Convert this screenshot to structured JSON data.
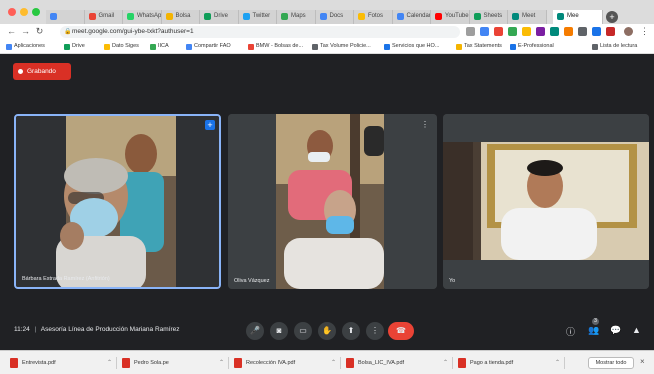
{
  "browser": {
    "tabs": [
      {
        "label": "",
        "color": "#4285f4"
      },
      {
        "label": "Gmail",
        "color": "#ea4335"
      },
      {
        "label": "WhatsApp",
        "color": "#25d366"
      },
      {
        "label": "Bolsa",
        "color": "#f4b400"
      },
      {
        "label": "Drive",
        "color": "#0f9d58"
      },
      {
        "label": "Twitter",
        "color": "#1da1f2"
      },
      {
        "label": "Maps",
        "color": "#34a853"
      },
      {
        "label": "Docs",
        "color": "#4285f4"
      },
      {
        "label": "Fotos",
        "color": "#fbbc04"
      },
      {
        "label": "Calendar",
        "color": "#4285f4"
      },
      {
        "label": "YouTube",
        "color": "#ff0000"
      },
      {
        "label": "Sheets",
        "color": "#0f9d58"
      },
      {
        "label": "Meet",
        "color": "#00897b"
      }
    ],
    "active_tab_label": "Mee",
    "url": "meet.google.com/gui-ybe-txkt?authuser=1",
    "bookmarks": [
      {
        "label": "Aplicaciones",
        "color": "#4285f4"
      },
      {
        "label": "Drive",
        "color": "#0f9d58"
      },
      {
        "label": "Dato Siges",
        "color": "#fbbc04"
      },
      {
        "label": "IICA",
        "color": "#34a853"
      },
      {
        "label": "Compartir FAO",
        "color": "#4285f4"
      },
      {
        "label": "BMW - Bolsas de...",
        "color": "#ea4335"
      },
      {
        "label": "Tax Volume Policie...",
        "color": "#5f6368"
      },
      {
        "label": "Servicios que HO...",
        "color": "#1a73e8"
      },
      {
        "label": "Tax Statements",
        "color": "#f4b400"
      },
      {
        "label": "E-Professional",
        "color": "#1a73e8"
      },
      {
        "label": "Lista de lectura",
        "color": "#5f6368"
      }
    ]
  },
  "meet": {
    "recording_label": "Grabando",
    "participants": [
      {
        "name": "Bárbara Estrada Ramírez (Anfitrión)"
      },
      {
        "name": "Oliva Vázquez"
      },
      {
        "name": "Yo"
      }
    ],
    "time": "11:24",
    "separator": "|",
    "meeting_title": "Asesoría Línea de Producción Mariana Ramírez",
    "colors": {
      "leave": "#ea4335",
      "active_border": "#8ab4f8",
      "recording": "#d93025"
    },
    "participant_count": "3"
  },
  "downloads": {
    "items": [
      {
        "name": "Entrevista.pdf"
      },
      {
        "name": "Pedro Sola.pe"
      },
      {
        "name": "Recolección IVA.pdf"
      },
      {
        "name": "Bolsa_LIC_IVA.pdf"
      },
      {
        "name": "Pago a tienda.pdf"
      }
    ],
    "show_all": "Mostrar todo",
    "close": "×"
  }
}
